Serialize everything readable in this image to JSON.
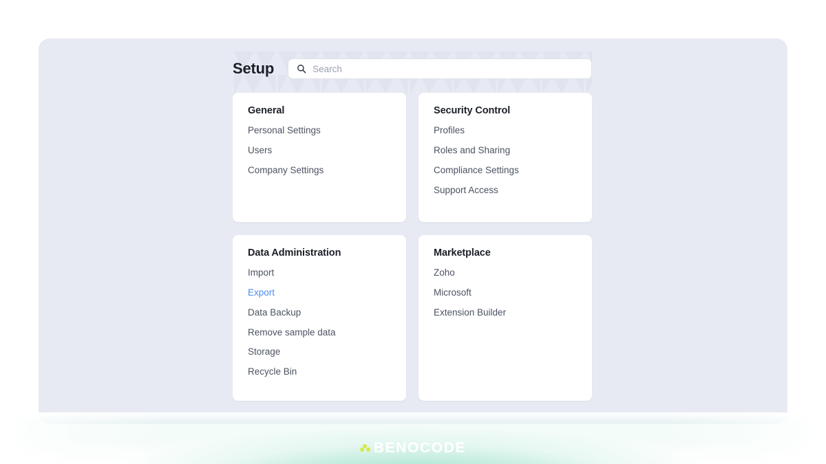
{
  "header": {
    "title": "Setup",
    "search": {
      "placeholder": "Search",
      "value": "",
      "icon": "search-icon"
    }
  },
  "colors": {
    "panel_bg": "#e7eaf2",
    "card_bg": "#ffffff",
    "title_text": "#1b1f27",
    "link_text": "#4b5261",
    "active_link": "#4d8ef0",
    "brand_green": "#89dcc1",
    "logo_accent": "#d7e84a"
  },
  "cards": [
    {
      "title": "General",
      "items": [
        {
          "label": "Personal Settings",
          "active": false
        },
        {
          "label": "Users",
          "active": false
        },
        {
          "label": "Company Settings",
          "active": false
        }
      ]
    },
    {
      "title": "Security Control",
      "items": [
        {
          "label": "Profiles",
          "active": false
        },
        {
          "label": "Roles and Sharing",
          "active": false
        },
        {
          "label": "Compliance Settings",
          "active": false
        },
        {
          "label": "Support Access",
          "active": false
        }
      ]
    },
    {
      "title": "Data Administration",
      "items": [
        {
          "label": "Import",
          "active": false
        },
        {
          "label": "Export",
          "active": true
        },
        {
          "label": "Data Backup",
          "active": false
        },
        {
          "label": "Remove sample data",
          "active": false
        },
        {
          "label": "Storage",
          "active": false
        },
        {
          "label": "Recycle Bin",
          "active": false
        }
      ]
    },
    {
      "title": "Marketplace",
      "items": [
        {
          "label": "Zoho",
          "active": false
        },
        {
          "label": "Microsoft",
          "active": false
        },
        {
          "label": "Extension Builder",
          "active": false
        }
      ]
    }
  ],
  "footer": {
    "logo_text": "BENOCODE"
  }
}
